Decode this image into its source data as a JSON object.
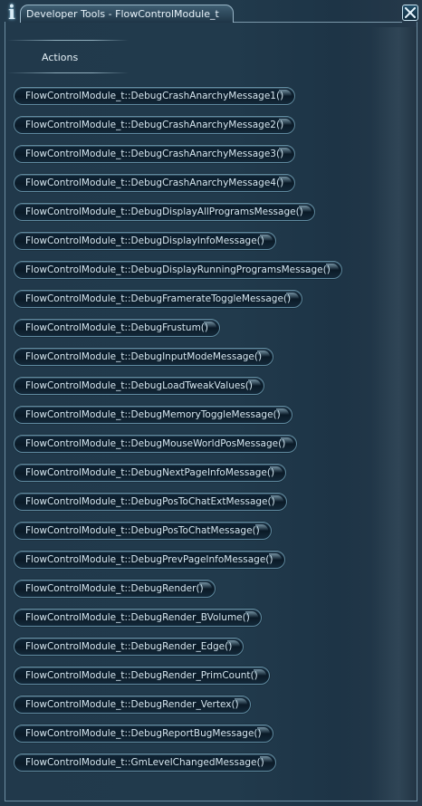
{
  "window": {
    "title": "Developer Tools - FlowControlModule_t",
    "info_icon": "info-icon",
    "close_icon": "close-icon"
  },
  "section": {
    "title": "Actions"
  },
  "actions": [
    "FlowControlModule_t::DebugCrashAnarchyMessage1()",
    "FlowControlModule_t::DebugCrashAnarchyMessage2()",
    "FlowControlModule_t::DebugCrashAnarchyMessage3()",
    "FlowControlModule_t::DebugCrashAnarchyMessage4()",
    "FlowControlModule_t::DebugDisplayAllProgramsMessage()",
    "FlowControlModule_t::DebugDisplayInfoMessage()",
    "FlowControlModule_t::DebugDisplayRunningProgramsMessage()",
    "FlowControlModule_t::DebugFramerateToggleMessage()",
    "FlowControlModule_t::DebugFrustum()",
    "FlowControlModule_t::DebugInputModeMessage()",
    "FlowControlModule_t::DebugLoadTweakValues()",
    "FlowControlModule_t::DebugMemoryToggleMessage()",
    "FlowControlModule_t::DebugMouseWorldPosMessage()",
    "FlowControlModule_t::DebugNextPageInfoMessage()",
    "FlowControlModule_t::DebugPosToChatExtMessage()",
    "FlowControlModule_t::DebugPosToChatMessage()",
    "FlowControlModule_t::DebugPrevPageInfoMessage()",
    "FlowControlModule_t::DebugRender()",
    "FlowControlModule_t::DebugRender_BVolume()",
    "FlowControlModule_t::DebugRender_Edge()",
    "FlowControlModule_t::DebugRender_PrimCount()",
    "FlowControlModule_t::DebugRender_Vertex()",
    "FlowControlModule_t::DebugReportBugMessage()",
    "FlowControlModule_t::GmLevelChangedMessage()"
  ]
}
